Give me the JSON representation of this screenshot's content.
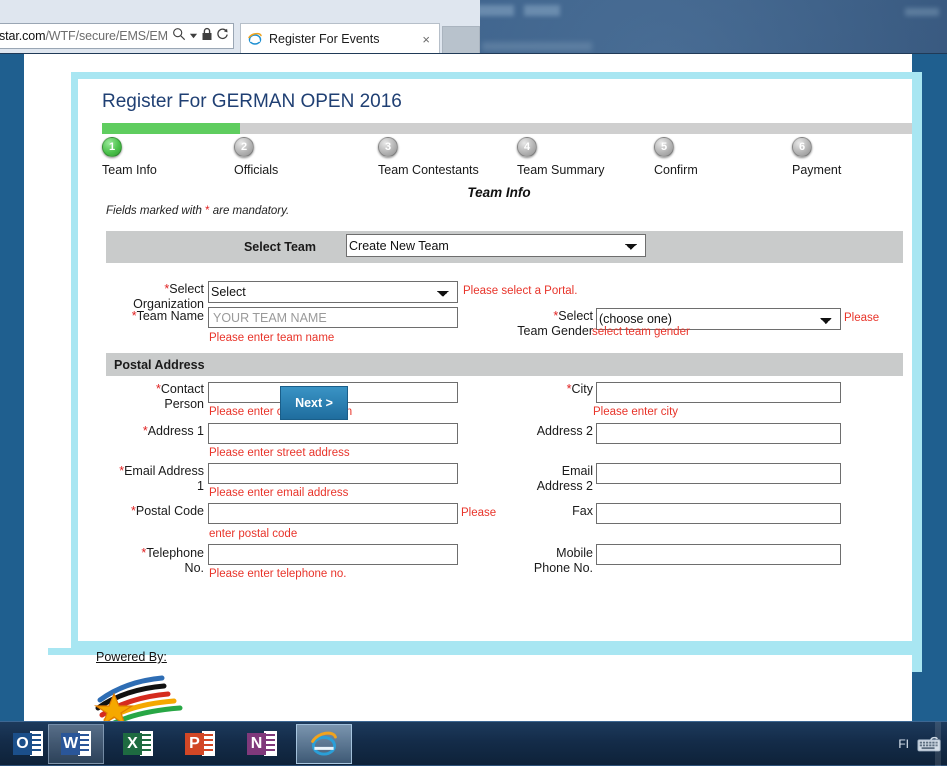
{
  "browser": {
    "url_host": "star.com",
    "url_path": "/WTF/secure/EMS/EM!",
    "tab_title": "Register For Events",
    "tab_close_glyph": "×",
    "search_icon": "search-icon",
    "lock_icon": "lock-icon",
    "refresh_icon": "refresh-icon"
  },
  "page": {
    "title": "Register For GERMAN OPEN 2016",
    "section_title": "Team Info",
    "mandatory_note_before": "Fields marked with ",
    "mandatory_star": "*",
    "mandatory_note_after": " are mandatory.",
    "progress_percent": 17
  },
  "steps": [
    {
      "num": "1",
      "label": "Team Info",
      "state": "done"
    },
    {
      "num": "2",
      "label": "Officials",
      "state": "todo"
    },
    {
      "num": "3",
      "label": "Team Contestants",
      "state": "todo"
    },
    {
      "num": "4",
      "label": "Team Summary",
      "state": "todo"
    },
    {
      "num": "5",
      "label": "Confirm",
      "state": "todo"
    },
    {
      "num": "6",
      "label": "Payment",
      "state": "todo"
    }
  ],
  "select_team": {
    "label": "Select Team",
    "value": "Create New Team",
    "options": [
      "Create New Team"
    ]
  },
  "fields": {
    "select_organization": {
      "label_star": "*",
      "label_line1": "Select",
      "label_line2": "Organization",
      "value": "Select",
      "options": [
        "Select"
      ],
      "error": "Please select a Portal."
    },
    "team_name": {
      "label_star": "*",
      "label": "Team Name",
      "value": "",
      "placeholder": "YOUR TEAM NAME",
      "error": "Please enter team name"
    },
    "select_team_gender": {
      "label_star": "*",
      "label_line1": "Select",
      "label_line2": "Team Gender",
      "value": "(choose one)",
      "options": [
        "(choose one)"
      ],
      "error_part1": "Please",
      "error_part2": "select team gender"
    }
  },
  "postal_address": {
    "header": "Postal Address",
    "contact_person": {
      "label_star": "*",
      "label_line1": "Contact",
      "label_line2": "Person",
      "value": "",
      "error": "Please enter contact person"
    },
    "address_1": {
      "label_star": "*",
      "label": "Address 1",
      "value": "",
      "error": "Please enter street address"
    },
    "email_address_1": {
      "label_star": "*",
      "label_line1": "Email Address",
      "label_line2": "1",
      "value": "",
      "error": "Please enter email address"
    },
    "postal_code": {
      "label_star": "*",
      "label": "Postal Code",
      "value": "",
      "error_part1": "Please",
      "error_part2": "enter postal code"
    },
    "telephone_no": {
      "label_star": "*",
      "label_line1": "Telephone",
      "label_line2": "No.",
      "value": "",
      "error": "Please enter telephone no."
    },
    "city": {
      "label_star": "*",
      "label": "City",
      "value": "",
      "error": "Please enter city"
    },
    "address_2": {
      "label": "Address 2",
      "value": ""
    },
    "email_address_2": {
      "label_line1": "Email",
      "label_line2": "Address 2",
      "value": ""
    },
    "fax": {
      "label": "Fax",
      "value": ""
    },
    "mobile_phone_no": {
      "label_line1": "Mobile",
      "label_line2": "Phone No.",
      "value": ""
    }
  },
  "next_button": {
    "label": "Next >"
  },
  "footer": {
    "powered_by": "Powered By:"
  },
  "taskbar": {
    "apps": [
      {
        "name": "outlook",
        "letter": "O",
        "color": "#1b4f8a",
        "state": "normal"
      },
      {
        "name": "word",
        "letter": "W",
        "color": "#2a5699",
        "state": "hover"
      },
      {
        "name": "excel",
        "letter": "X",
        "color": "#1e6b41",
        "state": "normal"
      },
      {
        "name": "powerpoint",
        "letter": "P",
        "color": "#d24726",
        "state": "normal"
      },
      {
        "name": "onenote",
        "letter": "N",
        "color": "#80397b",
        "state": "normal"
      },
      {
        "name": "internet-explorer",
        "letter": "e",
        "color": "#2a9fd8",
        "state": "active"
      }
    ],
    "language": "FI",
    "keyboard_icon": "keyboard-icon"
  },
  "colors": {
    "accent_cyan": "#a8e6f2",
    "accent_blue": "#1f5f8f",
    "title_blue": "#1f3f73",
    "progress_green": "#5fcd5f",
    "error_red": "#e8342a",
    "grey_bar": "#c9cbcb"
  }
}
